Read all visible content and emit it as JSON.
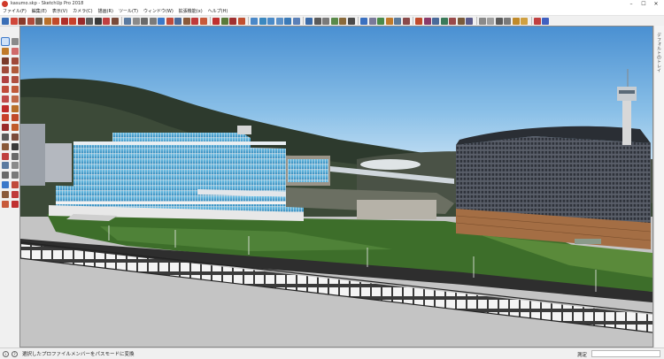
{
  "window": {
    "title": "kasumo.skp - SketchUp Pro 2018",
    "controls": {
      "minimize": "–",
      "maximize": "☐",
      "close": "✕"
    }
  },
  "menubar": {
    "items": [
      {
        "label": "ファイル(F)"
      },
      {
        "label": "編集(E)"
      },
      {
        "label": "表示(V)"
      },
      {
        "label": "カメラ(C)"
      },
      {
        "label": "描画(R)"
      },
      {
        "label": "ツール(T)"
      },
      {
        "label": "ウィンドウ(W)"
      },
      {
        "label": "拡張機能(x)"
      },
      {
        "label": "ヘルプ(H)"
      }
    ]
  },
  "toolbar": {
    "buttons": [
      {
        "icon": "select-icon",
        "color": "#3b6fb6"
      },
      {
        "icon": "eraser-icon",
        "color": "#d0473a"
      },
      {
        "icon": "line-icon",
        "color": "#8a3a2a"
      },
      {
        "icon": "arc-icon",
        "color": "#b04a3a"
      },
      {
        "icon": "rectangle-icon",
        "color": "#6a5a4a"
      },
      {
        "icon": "push-pull-icon",
        "color": "#b8702a"
      },
      {
        "icon": "offset-icon",
        "color": "#c04a2a"
      },
      {
        "icon": "move-icon",
        "color": "#b0302a"
      },
      {
        "icon": "rotate-icon",
        "color": "#c8402a"
      },
      {
        "icon": "scale-icon",
        "color": "#9a2a2a"
      },
      {
        "icon": "tape-icon",
        "color": "#5a5a5a"
      },
      {
        "icon": "text-icon",
        "color": "#3a3a3a"
      },
      {
        "icon": "axes-icon",
        "color": "#c04040"
      },
      {
        "icon": "dimension-icon",
        "color": "#7a4a3a"
      },
      {
        "icon": "sep"
      },
      {
        "icon": "orbit-icon",
        "color": "#5a7aa0"
      },
      {
        "icon": "pan-icon",
        "color": "#8a8a8a"
      },
      {
        "icon": "zoom-icon",
        "color": "#6a6a6a"
      },
      {
        "icon": "zoom-window-icon",
        "color": "#7a7a7a"
      },
      {
        "icon": "zoom-extents-icon",
        "color": "#3a78c9"
      },
      {
        "icon": "previous-icon",
        "color": "#c04a3a"
      },
      {
        "icon": "next-icon",
        "color": "#4a6a9a"
      },
      {
        "icon": "position-camera-icon",
        "color": "#8a5a3a"
      },
      {
        "icon": "walk-icon",
        "color": "#c03a3a"
      },
      {
        "icon": "look-around-icon",
        "color": "#c85a3a"
      },
      {
        "icon": "sep"
      },
      {
        "icon": "section-icon",
        "color": "#c03030"
      },
      {
        "icon": "sandbox-icon",
        "color": "#5a7a3a"
      },
      {
        "icon": "warehouse-icon",
        "color": "#a03030"
      },
      {
        "icon": "geo-icon",
        "color": "#c05030"
      },
      {
        "icon": "sep"
      },
      {
        "icon": "iso-view-icon",
        "color": "#4a88c8"
      },
      {
        "icon": "top-view-icon",
        "color": "#3a88c0"
      },
      {
        "icon": "front-view-icon",
        "color": "#4a8ac8"
      },
      {
        "icon": "right-view-icon",
        "color": "#5a90c8"
      },
      {
        "icon": "back-view-icon",
        "color": "#3a7ab8"
      },
      {
        "icon": "left-view-icon",
        "color": "#5a80b8"
      },
      {
        "icon": "sep"
      },
      {
        "icon": "xray-icon",
        "color": "#3a6aa8"
      },
      {
        "icon": "wireframe-icon",
        "color": "#5a5a5a"
      },
      {
        "icon": "hidden-line-icon",
        "color": "#7a7a7a"
      },
      {
        "icon": "shaded-icon",
        "color": "#5a8a4a"
      },
      {
        "icon": "textured-icon",
        "color": "#8a6a3a"
      },
      {
        "icon": "monochrome-icon",
        "color": "#4a4a4a"
      },
      {
        "icon": "sep"
      },
      {
        "icon": "help-icon",
        "color": "#3a70c0"
      },
      {
        "icon": "layers-icon",
        "color": "#7a7a9a"
      },
      {
        "icon": "components-icon",
        "color": "#4a8a4a"
      },
      {
        "icon": "materials-icon",
        "color": "#c07a2a"
      },
      {
        "icon": "styles-icon",
        "color": "#5a7a9a"
      },
      {
        "icon": "scenes-icon",
        "color": "#8a4a4a"
      },
      {
        "icon": "sep"
      },
      {
        "icon": "follow-me-icon",
        "color": "#c04a2a"
      },
      {
        "icon": "intersect-icon",
        "color": "#8a3a6a"
      },
      {
        "icon": "outer-shell-icon",
        "color": "#4a6a9a"
      },
      {
        "icon": "union-icon",
        "color": "#3a7a5a"
      },
      {
        "icon": "subtract-icon",
        "color": "#9a4a4a"
      },
      {
        "icon": "trim-icon",
        "color": "#7a5a3a"
      },
      {
        "icon": "split-icon",
        "color": "#5a5a8a"
      },
      {
        "icon": "sep"
      },
      {
        "icon": "shadows-icon",
        "color": "#8a8a8a"
      },
      {
        "icon": "fog-icon",
        "color": "#a0a0a0"
      },
      {
        "icon": "hide-icon",
        "color": "#5a5a5a"
      },
      {
        "icon": "unhide-icon",
        "color": "#7a7a7a"
      },
      {
        "icon": "lock-icon",
        "color": "#c08a2a"
      },
      {
        "icon": "unlock-icon",
        "color": "#d0a040"
      },
      {
        "icon": "sep"
      },
      {
        "icon": "extension-a-icon",
        "color": "#c04040"
      },
      {
        "icon": "extension-b-icon",
        "color": "#4060c0"
      }
    ]
  },
  "palette": {
    "buttons": [
      {
        "icon": "select-icon",
        "color": "#3b6fb6",
        "selected": true
      },
      {
        "icon": "make-component-icon",
        "color": "#8a8a8a"
      },
      {
        "icon": "paint-bucket-icon",
        "color": "#c07a2a"
      },
      {
        "icon": "eraser-icon",
        "color": "#d06a6a"
      },
      {
        "icon": "line-icon",
        "color": "#7a3a2a"
      },
      {
        "icon": "freehand-icon",
        "color": "#a04a3a"
      },
      {
        "icon": "rectangle-icon",
        "color": "#a04a3a"
      },
      {
        "icon": "rotated-rect-icon",
        "color": "#b05a3a"
      },
      {
        "icon": "circle-icon",
        "color": "#b04040"
      },
      {
        "icon": "polygon-icon",
        "color": "#b05040"
      },
      {
        "icon": "arc-icon",
        "color": "#c04a3a"
      },
      {
        "icon": "two-point-arc-icon",
        "color": "#c05a3a"
      },
      {
        "icon": "three-point-arc-icon",
        "color": "#c04a4a"
      },
      {
        "icon": "pie-icon",
        "color": "#c06a4a"
      },
      {
        "icon": "move-icon",
        "color": "#c02a2a"
      },
      {
        "icon": "push-pull-icon",
        "color": "#b8702a"
      },
      {
        "icon": "rotate-icon",
        "color": "#c8402a"
      },
      {
        "icon": "follow-me-icon",
        "color": "#c04a2a"
      },
      {
        "icon": "scale-icon",
        "color": "#9a2a2a"
      },
      {
        "icon": "offset-icon",
        "color": "#c05a2a"
      },
      {
        "icon": "tape-icon",
        "color": "#5a5a5a"
      },
      {
        "icon": "dimension-icon",
        "color": "#7a4a3a"
      },
      {
        "icon": "protractor-icon",
        "color": "#8a5a3a"
      },
      {
        "icon": "text-icon",
        "color": "#3a3a3a"
      },
      {
        "icon": "axes-icon",
        "color": "#c04040"
      },
      {
        "icon": "3d-text-icon",
        "color": "#6a6a6a"
      },
      {
        "icon": "orbit-icon",
        "color": "#5a7aa0"
      },
      {
        "icon": "pan-icon",
        "color": "#8a8a8a"
      },
      {
        "icon": "zoom-icon",
        "color": "#6a6a6a"
      },
      {
        "icon": "zoom-window-icon",
        "color": "#7a7a7a"
      },
      {
        "icon": "zoom-extents-icon",
        "color": "#3a78c9"
      },
      {
        "icon": "previous-icon",
        "color": "#c04a3a"
      },
      {
        "icon": "position-camera-icon",
        "color": "#8a5a3a"
      },
      {
        "icon": "walk-icon",
        "color": "#c03a3a"
      },
      {
        "icon": "look-around-icon",
        "color": "#c85a3a"
      },
      {
        "icon": "section-icon",
        "color": "#c03030"
      }
    ]
  },
  "tray": {
    "label": "デフォルトのトレイ"
  },
  "status": {
    "icon_1": "i",
    "icon_2": "?",
    "message": "選択したプロファイルメンバーをパスモードに変換",
    "measurements_label": "測定"
  },
  "colors": {
    "sky_top": "#4a90d2",
    "sky_bottom": "#dcecf8",
    "grass": "#3d6e2a",
    "building_glass": "#4aa8d6",
    "building_right": "#5a5f6a",
    "ground": "#c4c4c4"
  }
}
